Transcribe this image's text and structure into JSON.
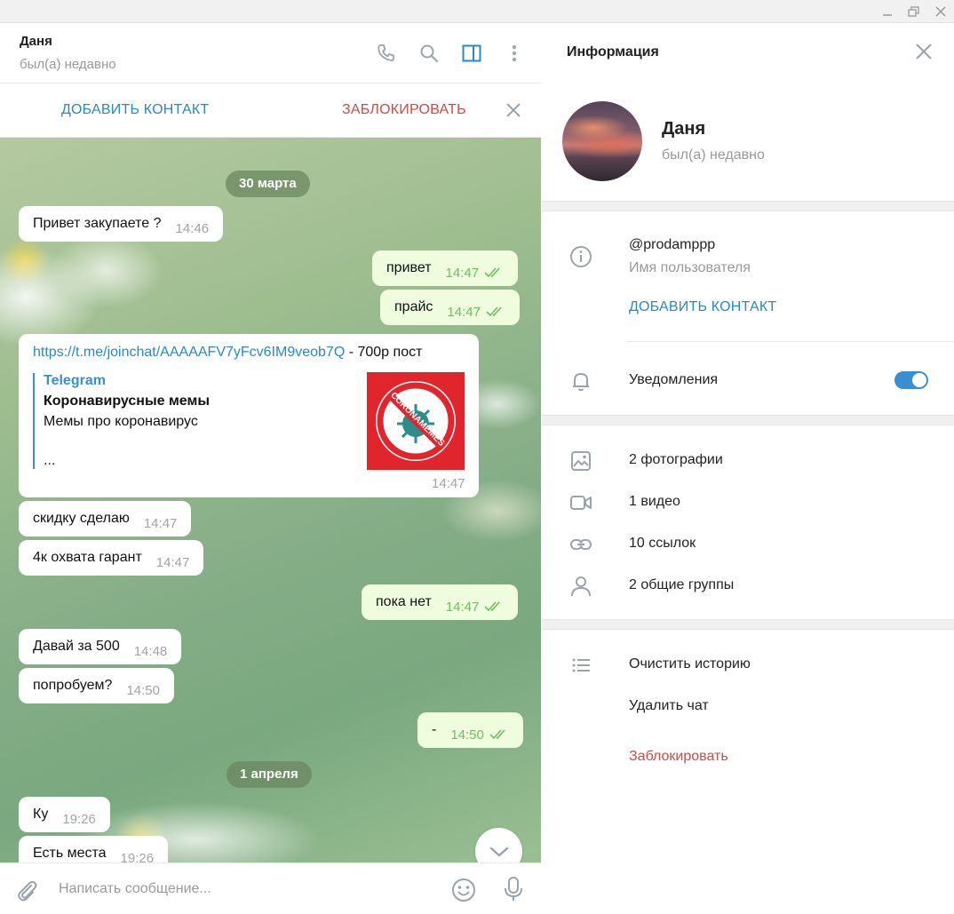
{
  "window": {
    "controls": [
      "minimize-icon",
      "maximize-icon",
      "close-icon"
    ]
  },
  "chat": {
    "peer_name": "Даня",
    "peer_status": "был(а) недавно",
    "header_icons": [
      "phone-icon",
      "search-icon",
      "sidebar-toggle-icon",
      "more-vertical-icon"
    ],
    "add_contact": "ДОБАВИТЬ КОНТАКТ",
    "block": "ЗАБЛОКИРОВАТЬ",
    "dates": [
      "30 марта",
      "1 апреля"
    ],
    "messages": [
      {
        "dir": "in",
        "text": "Привет закупаете ?",
        "time": "14:46"
      },
      {
        "dir": "out",
        "text": "привет",
        "time": "14:47",
        "read": true
      },
      {
        "dir": "out",
        "text": "прайс",
        "time": "14:47",
        "read": true
      },
      {
        "dir": "in",
        "type": "link",
        "url": "https://t.me/joinchat/AAAAAFV7yFcv6IM9veob7Q",
        "suffix": " - 700р пост",
        "time": "14:47"
      },
      {
        "dir": "in",
        "text": "скидку сделаю",
        "time": "14:47"
      },
      {
        "dir": "in",
        "text": "4к охвата гарант",
        "time": "14:47"
      },
      {
        "dir": "out",
        "text": "пока нет",
        "time": "14:47",
        "read": true
      },
      {
        "dir": "in",
        "text": "Давай за 500",
        "time": "14:48"
      },
      {
        "dir": "in",
        "text": "попробуем?",
        "time": "14:50"
      },
      {
        "dir": "out",
        "text": "-",
        "time": "14:50",
        "read": true
      },
      {
        "dir": "in",
        "text": "Ку",
        "time": "19:26"
      },
      {
        "dir": "in",
        "text": "Есть места",
        "time": "19:26"
      }
    ],
    "link_preview": {
      "site": "Telegram",
      "title": "Коронавирусные мемы",
      "description": "Мемы про коронавирус",
      "more": "...",
      "image_text": "CORONAMEMES"
    },
    "composer": {
      "placeholder": "Написать сообщение..."
    }
  },
  "info": {
    "title": "Информация",
    "name": "Даня",
    "status": "был(а) недавно",
    "username": "@prodamppp",
    "username_label": "Имя пользователя",
    "add_contact": "ДОБАВИТЬ КОНТАКТ",
    "notifications": "Уведомления",
    "notifications_on": true,
    "media": [
      {
        "icon": "photo-icon",
        "label": "2 фотографии"
      },
      {
        "icon": "video-icon",
        "label": "1 видео"
      },
      {
        "icon": "link-icon",
        "label": "10 ссылок"
      },
      {
        "icon": "user-icon",
        "label": "2 общие группы"
      }
    ],
    "clear_history": "Очистить историю",
    "delete_chat": "Удалить чат",
    "block": "Заблокировать",
    "colors": {
      "accent": "#2a88c6",
      "danger": "#d04a43",
      "outgoing": "#effdde"
    }
  }
}
